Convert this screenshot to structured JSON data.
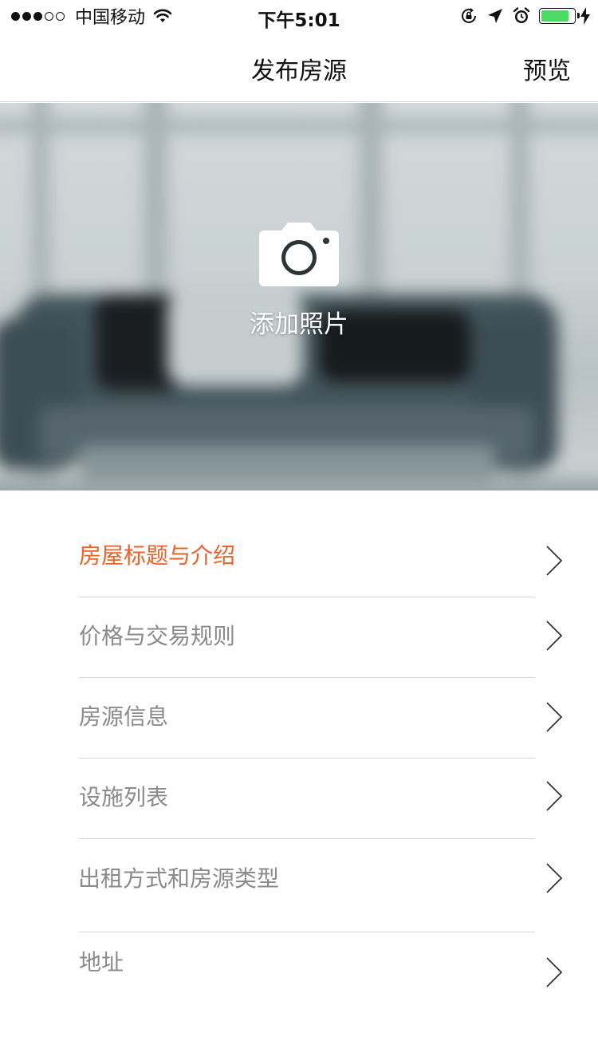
{
  "status_bar": {
    "carrier": "中国移动",
    "time": "下午5:01",
    "signal_bars_filled": 3,
    "signal_bars_total": 5,
    "battery_level": 0.85,
    "icons": [
      "wifi-icon",
      "rotation-lock-icon",
      "location-arrow-icon",
      "alarm-clock-icon",
      "battery-icon",
      "charging-bolt-icon"
    ]
  },
  "nav": {
    "title": "发布房源",
    "preview_label": "预览"
  },
  "hero": {
    "add_photo_label": "添加照片",
    "icon": "camera-icon"
  },
  "menu": {
    "items": [
      {
        "label": "房屋标题与介绍",
        "active": true
      },
      {
        "label": "价格与交易规则",
        "active": false
      },
      {
        "label": "房源信息",
        "active": false
      },
      {
        "label": "设施列表",
        "active": false
      },
      {
        "label": "出租方式和房源类型",
        "active": false
      },
      {
        "label": "地址",
        "active": false
      }
    ],
    "chevron_icon": "chevron-right-icon"
  },
  "colors": {
    "accent": "#e8632a",
    "inactive_text": "#8a8a8a",
    "battery": "#4cd964"
  }
}
